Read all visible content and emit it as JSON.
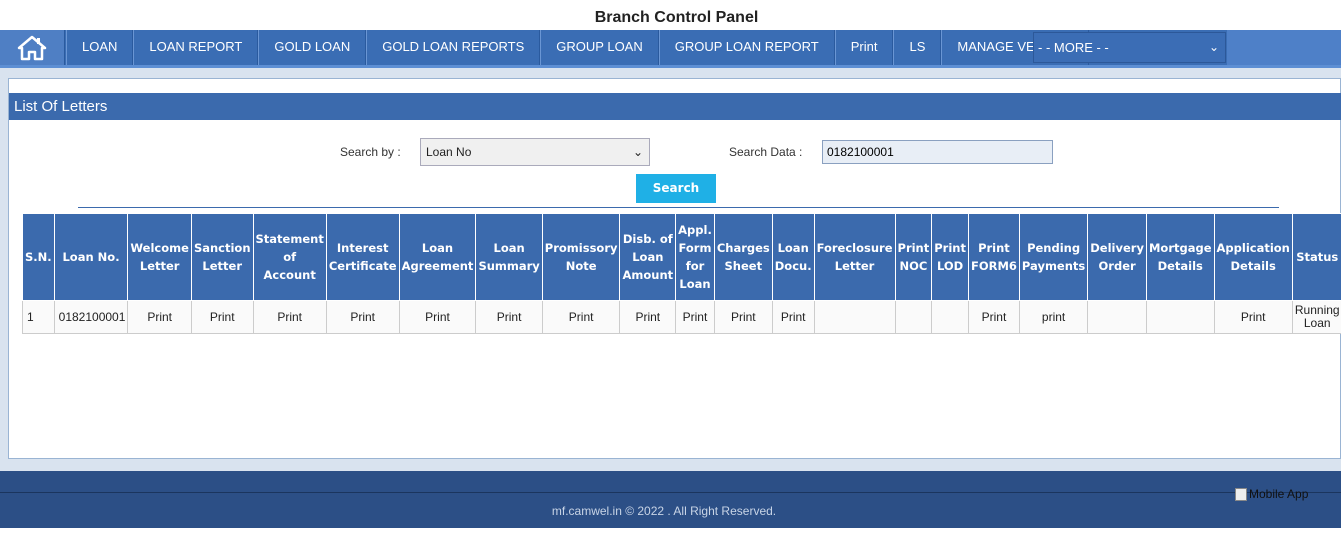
{
  "page_title": "Branch Control Panel",
  "nav": {
    "items": [
      "LOAN",
      "LOAN REPORT",
      "GOLD LOAN",
      "GOLD LOAN REPORTS",
      "GROUP LOAN",
      "GROUP LOAN REPORT",
      "Print",
      "LS",
      "MANAGE VENDOR"
    ],
    "more_label": "- - MORE - -"
  },
  "panel": {
    "title": "List Of Letters"
  },
  "search": {
    "search_by_label": "Search by :",
    "search_by_value": "Loan No",
    "search_data_label": "Search Data :",
    "search_data_value": "0182100001",
    "button_label": "Search"
  },
  "table": {
    "headers": [
      "S.N.",
      "Loan No.",
      "Welcome Letter",
      "Sanction Letter",
      "Statement of Account",
      "Interest Certificate",
      "Loan Agreement",
      "Loan Summary",
      "Promissory Note",
      "Disb. of Loan Amount",
      "Appl. Form for Loan",
      "Charges Sheet",
      "Loan Docu.",
      "Foreclosure Letter",
      "Print NOC",
      "Print LOD",
      "Print FORM6",
      "Pending Payments",
      "Delivery Order",
      "Mortgage Details",
      "Application Details",
      "Status"
    ],
    "rows": [
      [
        "1",
        "0182100001",
        "Print",
        "Print",
        "Print",
        "Print",
        "Print",
        "Print",
        "Print",
        "Print",
        "Print",
        "Print",
        "Print",
        "",
        "",
        "",
        "Print",
        "print",
        "",
        "",
        "Print",
        "Running Loan"
      ]
    ]
  },
  "footer": {
    "copyright": "mf.camwel.in © 2022 . All Right Reserved.",
    "mobile_app_alt": "Mobile App"
  },
  "colors": {
    "nav_bg": "#3a6db4",
    "panel_header": "#3b6aad",
    "search_button": "#1fb0e6",
    "footer_bg": "#2c4f86"
  }
}
